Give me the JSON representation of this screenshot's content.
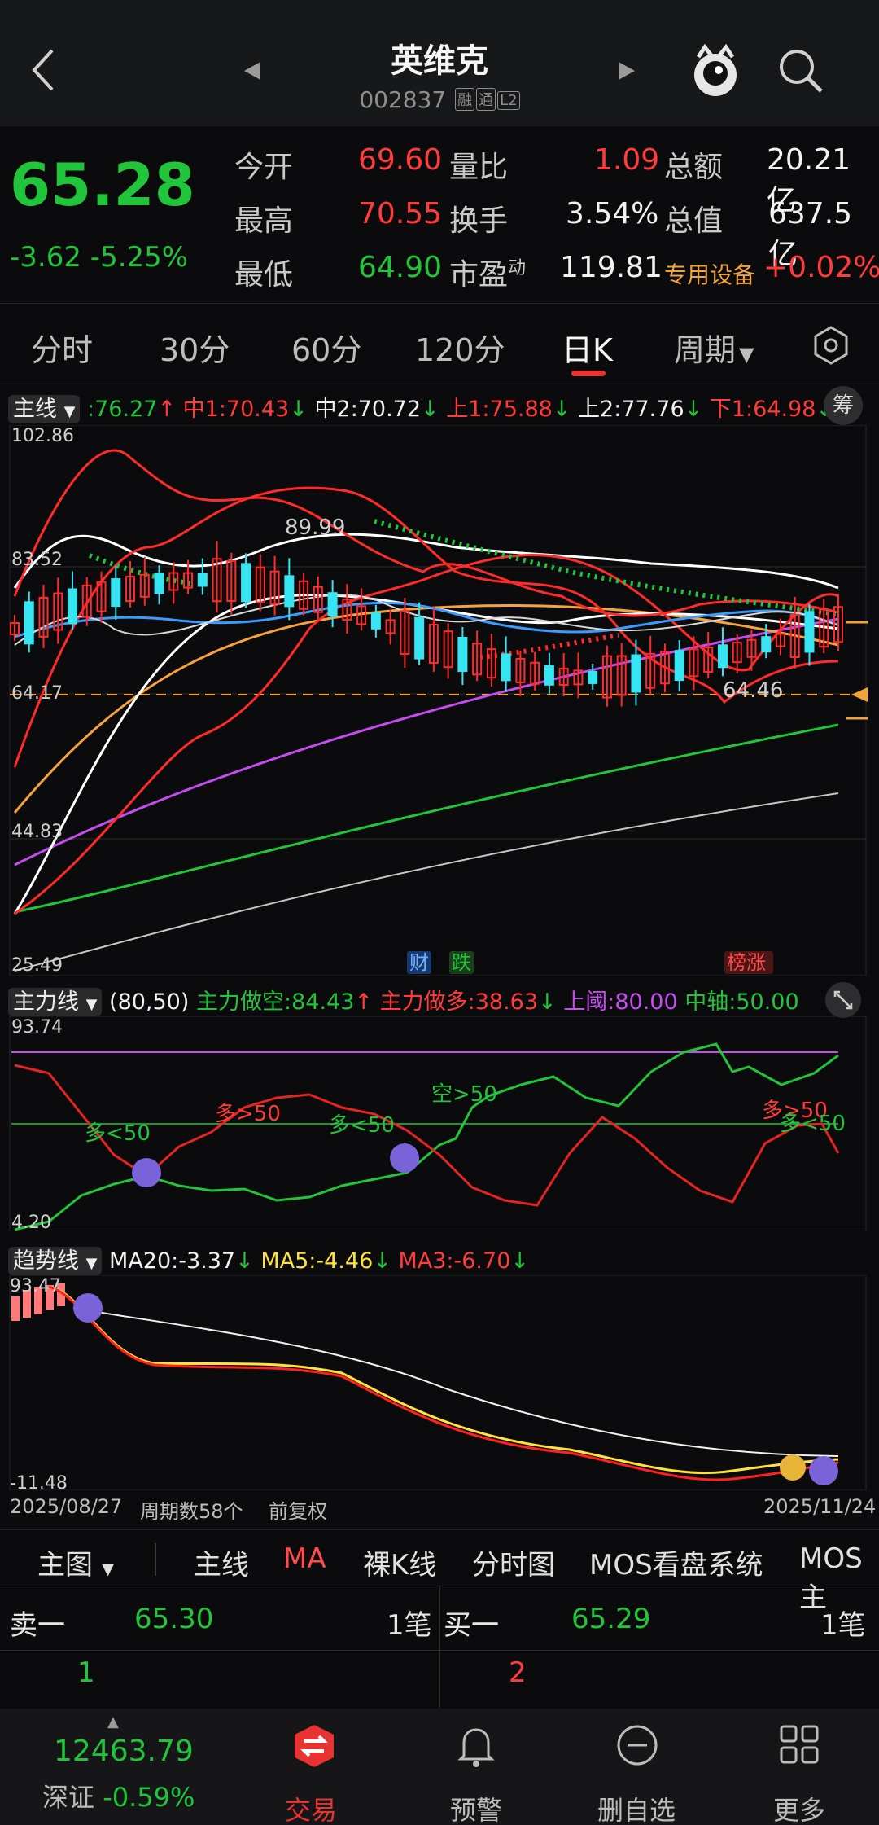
{
  "header": {
    "title": "英维克",
    "code": "002837",
    "tags": [
      "融",
      "通",
      "L2"
    ]
  },
  "quote": {
    "price": "65.28",
    "change": "-3.62",
    "change_pct": "-5.25%",
    "rows": [
      {
        "l1": "今开",
        "v1": "69.60",
        "l2": "量比",
        "v2": "1.09",
        "l3": "总额",
        "v3": "20.21亿"
      },
      {
        "l1": "最高",
        "v1": "70.55",
        "l2": "换手",
        "v2": "3.54%",
        "l3": "总值",
        "v3": "637.5亿"
      },
      {
        "l1": "最低",
        "v1": "64.90",
        "l2": "市盈",
        "l2_sup": "动",
        "v2": "119.81",
        "l3": "专用设备",
        "v3": "+0.02%"
      }
    ]
  },
  "tabs": [
    "分时",
    "30分",
    "60分",
    "120分",
    "日K",
    "周期"
  ],
  "main_indicator": {
    "name": "主线",
    "values": [
      {
        "label": ":76.27",
        "arrow": "↑"
      },
      {
        "label": "中1:70.43",
        "arrow": "↓"
      },
      {
        "label": "中2:70.72",
        "arrow": "↓"
      },
      {
        "label": "上1:75.88",
        "arrow": "↓"
      },
      {
        "label": "上2:77.76",
        "arrow": "↓"
      },
      {
        "label": "下1:64.98",
        "arrow": "↓"
      }
    ],
    "chip_button": "筹"
  },
  "chart_labels": {
    "y_top": "102.86",
    "y_mid": "83.52",
    "y_ref": "64.17",
    "y_low": "44.83",
    "y_bottom": "25.49",
    "high_marker": "89.99",
    "low_marker": "64.46",
    "event_tags": [
      "财",
      "跌",
      "榜涨"
    ]
  },
  "chart_data": {
    "type": "candlestick",
    "series": [
      {
        "name": "主线",
        "values": [
          60,
          62,
          64,
          66,
          68,
          70,
          71,
          72,
          73,
          74,
          74.5,
          75,
          75.5,
          76,
          76.27
        ]
      }
    ]
  },
  "sub1": {
    "name": "主力线",
    "params": "(80,50)",
    "values": [
      {
        "label": "主力做空:84.43",
        "arrow": "↑"
      },
      {
        "label": "主力做多:38.63",
        "arrow": "↓"
      },
      {
        "label": "上阈:80.00"
      },
      {
        "label": "中轴:50.00"
      }
    ],
    "y_top": "93.74",
    "y_bottom": "4.20",
    "annotations": [
      "多<50",
      "多>50",
      "多<50",
      "空>50",
      "多>50",
      "多<50"
    ]
  },
  "sub2": {
    "name": "趋势线",
    "values": [
      {
        "label": "MA20:-3.37",
        "arrow": "↓"
      },
      {
        "label": "MA5:-4.46",
        "arrow": "↓"
      },
      {
        "label": "MA3:-6.70",
        "arrow": "↓"
      }
    ],
    "y_top": "93.47",
    "y_bottom": "-11.48"
  },
  "date_bar": {
    "start": "2025/08/27",
    "periods": "周期数58个",
    "adjust": "前复权",
    "end": "2025/11/24"
  },
  "bottom_tabs": [
    "主图",
    "主线",
    "MA",
    "裸K线",
    "分时图",
    "MOS看盘系统",
    "MOS主"
  ],
  "order_book": {
    "sell_label": "卖一",
    "sell_price": "65.30",
    "sell_count": "1笔",
    "sell_vol": "1",
    "buy_label": "买一",
    "buy_price": "65.29",
    "buy_count": "1笔",
    "buy_vol": "2"
  },
  "nav": {
    "index_value": "12463.79",
    "index_name": "深证",
    "index_change": "-0.59%",
    "items": [
      "交易",
      "预警",
      "删自选",
      "更多"
    ]
  },
  "colors": {
    "up": "#ff3b3b",
    "down": "#21c43a",
    "accent": "#e83333",
    "price_fill": "#37e4f1"
  }
}
